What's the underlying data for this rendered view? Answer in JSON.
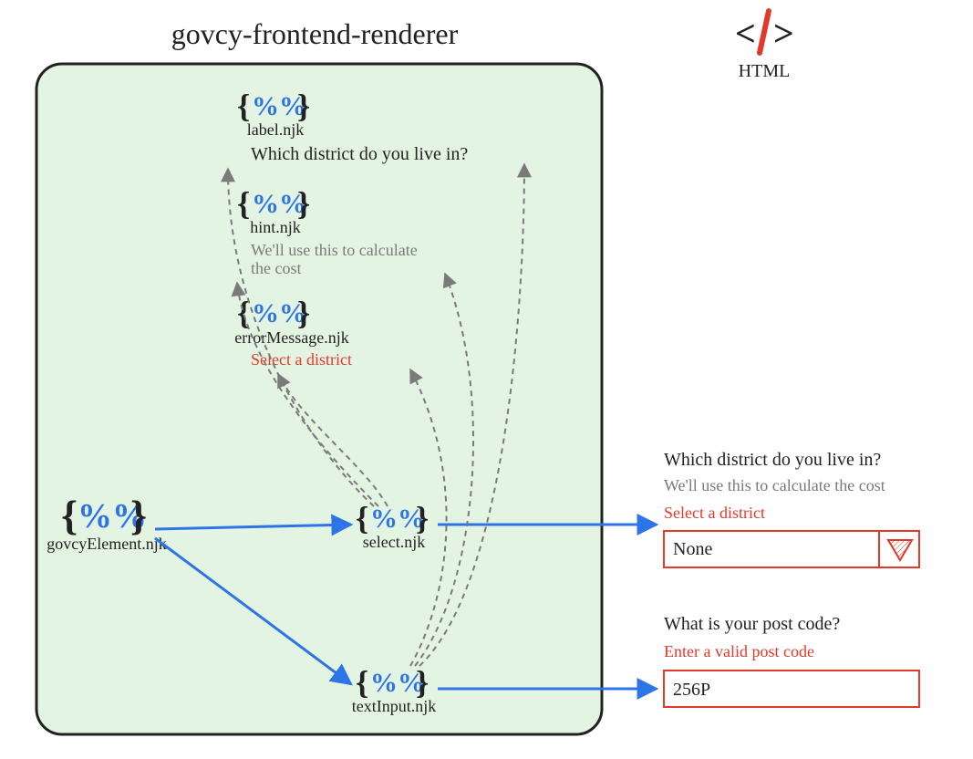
{
  "diagram": {
    "title": "govcy-frontend-renderer",
    "html_label": "HTML",
    "templates": {
      "root": {
        "symbol": "{%%}",
        "filename": "govcyElement.njk"
      },
      "label": {
        "symbol": "{%%}",
        "filename": "label.njk",
        "sample": "Which district do you live in?"
      },
      "hint": {
        "symbol": "{%%}",
        "filename": "hint.njk",
        "sample": "We'll use this to calculate the cost"
      },
      "error": {
        "symbol": "{%%}",
        "filename": "errorMessage.njk",
        "sample": "Select a district"
      },
      "select": {
        "symbol": "{%%}",
        "filename": "select.njk"
      },
      "textinput": {
        "symbol": "{%%}",
        "filename": "textInput.njk"
      }
    }
  },
  "output": {
    "select": {
      "label": "Which district do you live in?",
      "hint": "We'll use this to calculate the cost",
      "error": "Select a district",
      "value": "None"
    },
    "textinput": {
      "label": "What is your post code?",
      "error": "Enter a valid post code",
      "value": "256P"
    }
  }
}
